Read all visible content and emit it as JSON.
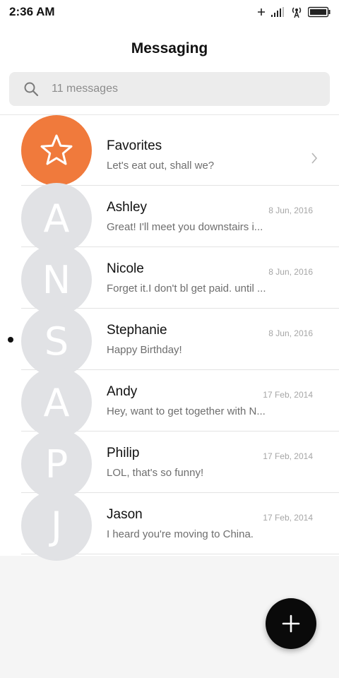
{
  "statusbar": {
    "time": "2:36 AM",
    "icons": [
      "plus-icon",
      "signal-bars-icon",
      "hotspot-icon",
      "battery-icon"
    ]
  },
  "header": {
    "title": "Messaging"
  },
  "search": {
    "placeholder": "11 messages",
    "icon": "search-icon"
  },
  "conversations": [
    {
      "name": "Favorites",
      "preview": "Let's eat out, shall we?",
      "date": "",
      "avatar": "star-icon",
      "avatar_color": "#f07a3c"
    },
    {
      "name": "Ashley",
      "preview": "Great! I'll meet you downstairs i...",
      "date": "8 Jun, 2016",
      "avatar": "A"
    },
    {
      "name": "Nicole",
      "preview": "Forget it.I don't bl get paid. until ...",
      "date": "8 Jun, 2016",
      "avatar": "N"
    },
    {
      "name": "Stephanie",
      "preview": "Happy Birthday!",
      "date": "8 Jun, 2016",
      "avatar": "S",
      "unread": true
    },
    {
      "name": "Andy",
      "preview": "Hey, want to get together with N...",
      "date": "17 Feb, 2014",
      "avatar": "A"
    },
    {
      "name": "Philip",
      "preview": "LOL, that's so funny!",
      "date": "17 Feb, 2014",
      "avatar": "P"
    },
    {
      "name": "Jason",
      "preview": "I heard you're moving to China.",
      "date": "17 Feb, 2014",
      "avatar": "J"
    }
  ],
  "fab": {
    "icon": "plus-icon"
  },
  "colors": {
    "accent": "#f07a3c",
    "avatar_gray": "#e1e2e5",
    "fab": "#0a0a0a"
  }
}
